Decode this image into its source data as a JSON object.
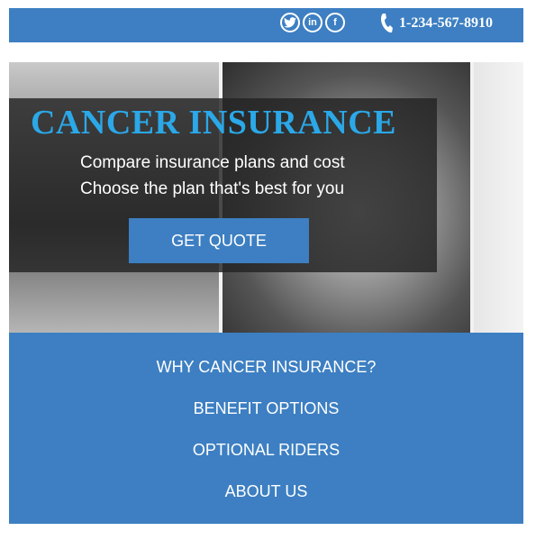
{
  "header": {
    "social": [
      {
        "icon": "twitter-icon",
        "glyph": "t"
      },
      {
        "icon": "linkedin-icon",
        "glyph": "in"
      },
      {
        "icon": "facebook-icon",
        "glyph": "f"
      }
    ],
    "phone": "1-234-567-8910"
  },
  "hero": {
    "title": "CANCER INSURANCE",
    "line1": "Compare insurance plans and cost",
    "line2": "Choose the plan that's best for you",
    "cta_label": "GET QUOTE"
  },
  "nav": {
    "items": [
      {
        "label": "WHY CANCER INSURANCE?"
      },
      {
        "label": "BENEFIT OPTIONS"
      },
      {
        "label": "OPTIONAL RIDERS"
      },
      {
        "label": "ABOUT US"
      }
    ]
  },
  "colors": {
    "brand_blue": "#3d7fc2",
    "title_blue": "#2ba8e8",
    "overlay": "#232323"
  }
}
